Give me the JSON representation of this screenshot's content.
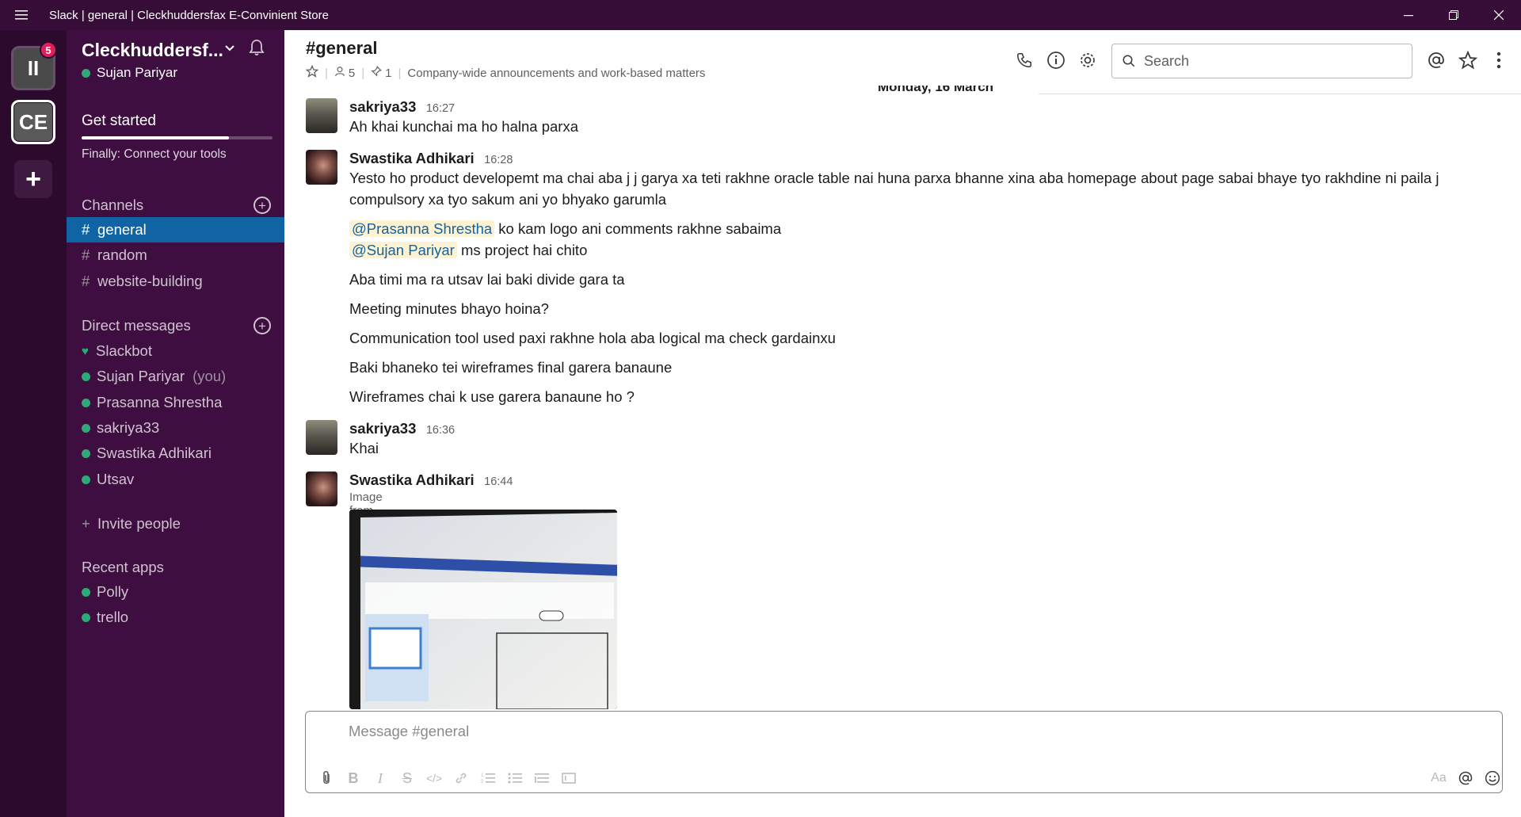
{
  "window": {
    "title": "Slack | general | Cleckhuddersfax E-Convinient Store"
  },
  "rail": {
    "workspaces": [
      {
        "initials": "II",
        "badge": "5"
      },
      {
        "initials": "CE"
      }
    ],
    "add_label": "+"
  },
  "sidebar": {
    "workspace_name": "Cleckhuddersf...",
    "user_name": "Sujan Pariyar",
    "get_started": {
      "label": "Get started",
      "progress": 0.77,
      "sub": "Finally: Connect your tools"
    },
    "channels_header": "Channels",
    "channels": [
      {
        "name": "general",
        "active": true
      },
      {
        "name": "random"
      },
      {
        "name": "website-building"
      }
    ],
    "dm_header": "Direct messages",
    "dms": [
      {
        "name": "Slackbot",
        "icon": "heart-icon"
      },
      {
        "name": "Sujan Pariyar",
        "suffix": "(you)"
      },
      {
        "name": "Prasanna Shrestha"
      },
      {
        "name": "sakriya33"
      },
      {
        "name": "Swastika Adhikari"
      },
      {
        "name": "Utsav"
      }
    ],
    "invite_label": "Invite people",
    "apps_header": "Recent apps",
    "apps": [
      {
        "name": "Polly"
      },
      {
        "name": "trello"
      }
    ]
  },
  "header": {
    "channel": "#general",
    "members": "5",
    "pinned": "1",
    "topic": "Company-wide announcements and work-based matters",
    "search_placeholder": "Search"
  },
  "messages": {
    "date": "Monday, 16 March",
    "items": [
      {
        "author": "sakriya33",
        "time": "16:27",
        "lines": [
          "Ah khai kunchai ma ho halna parxa"
        ]
      },
      {
        "author": "Swastika Adhikari",
        "time": "16:28",
        "text1": "Yesto ho product developemt ma chai aba j j garya xa teti rakhne oracle table nai huna parxa bhanne xina aba homepage about page sabai bhaye tyo rakhdine ni paila j compulsory xa tyo sakum ani yo bhyako garumla",
        "mention1": "@Prasanna Shrestha",
        "after1": " ko kam logo ani comments rakhne sabaima",
        "mention2": "@Sujan Pariyar",
        "after2": " ms project hai chito",
        "line3": "Aba timi ma ra utsav lai baki divide gara ta",
        "line4": "Meeting minutes bhayo hoina?",
        "line5": "Communication tool used paxi rakhne hola aba logical ma check gardainxu",
        "line6": "Baki bhaneko tei wireframes final garera banaune",
        "line7": "Wireframes chai k use garera banaune ho ?"
      },
      {
        "author": "sakriya33",
        "time": "16:36",
        "lines": [
          "Khai"
        ]
      },
      {
        "author": "Swastika Adhikari",
        "time": "16:44",
        "file_label": "Image from iOS"
      }
    ]
  },
  "composer": {
    "placeholder": "Message #general",
    "format_label": "Aa"
  }
}
